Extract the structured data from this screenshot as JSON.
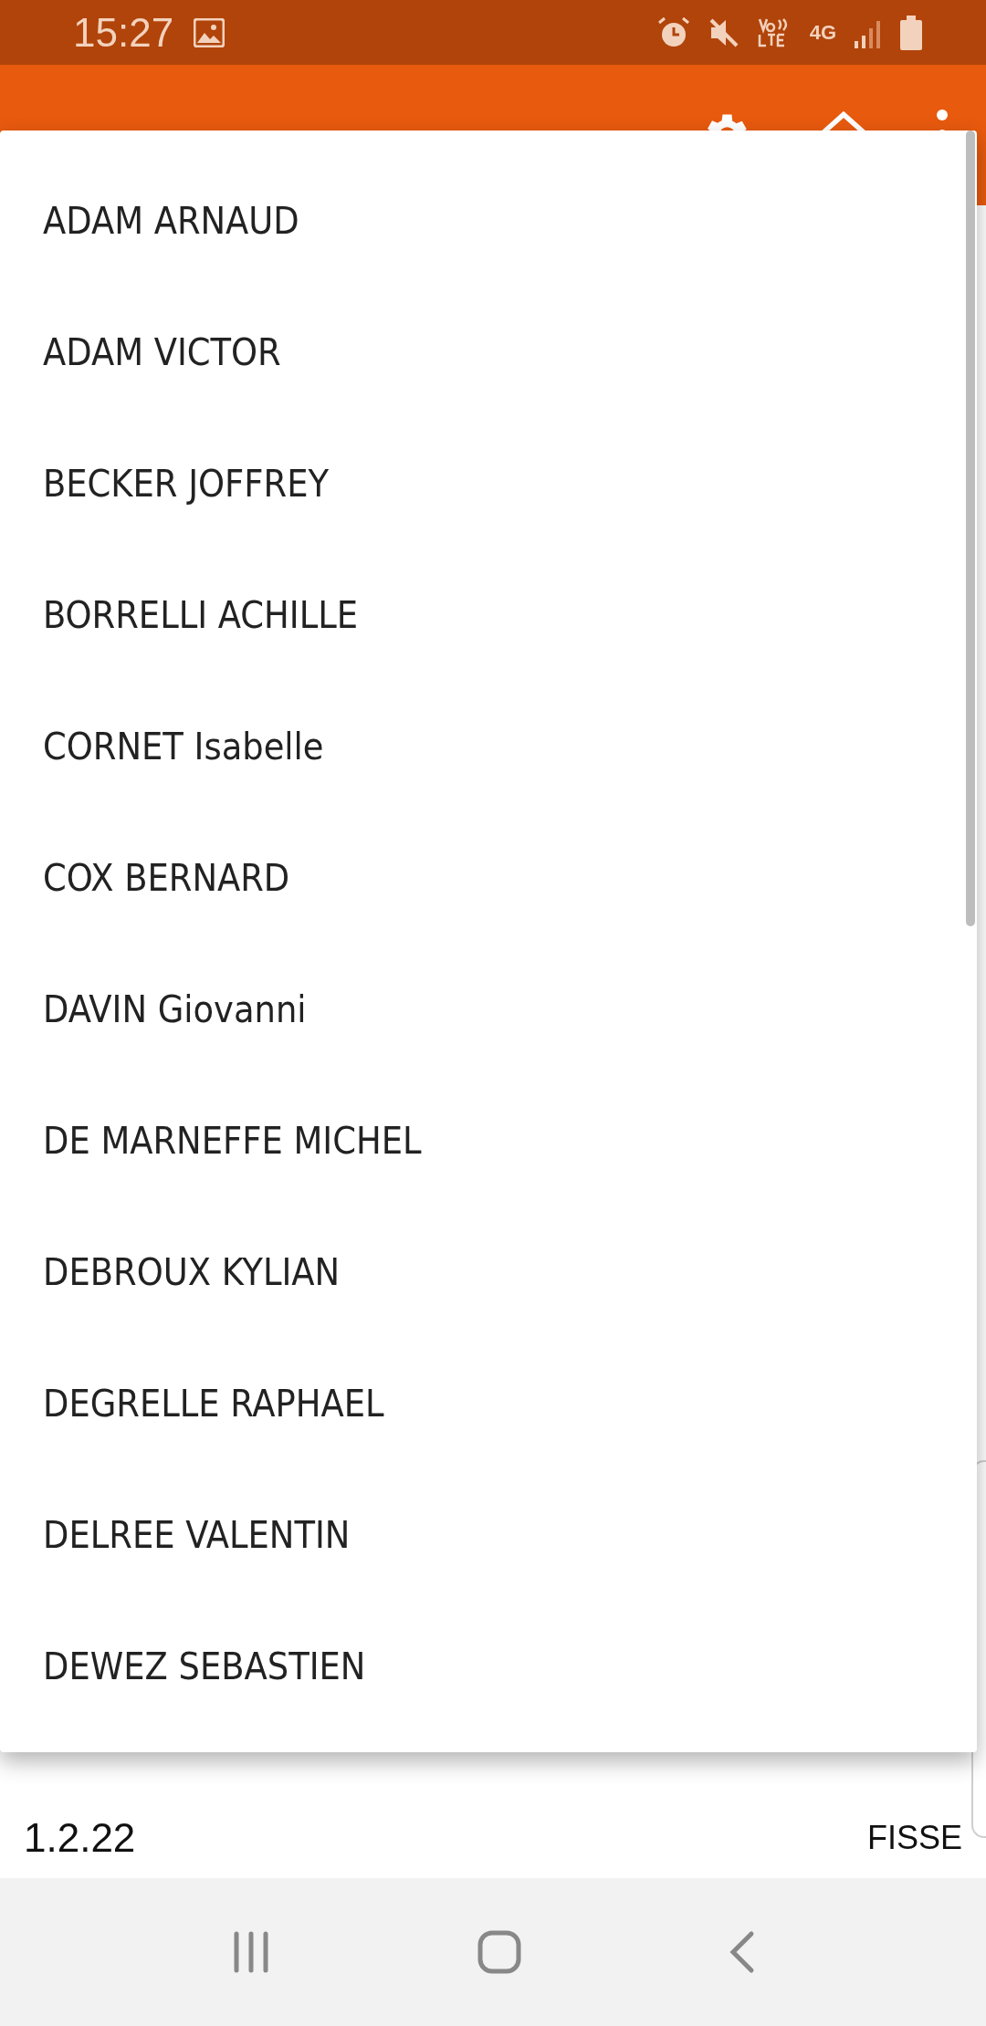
{
  "status_bar": {
    "time": "15:27",
    "network": "4G"
  },
  "dropdown": {
    "items": [
      {
        "label": "ADAM ARNAUD"
      },
      {
        "label": "ADAM VICTOR"
      },
      {
        "label": "BECKER JOFFREY"
      },
      {
        "label": "BORRELLI ACHILLE"
      },
      {
        "label": "CORNET Isabelle"
      },
      {
        "label": "COX BERNARD"
      },
      {
        "label": "DAVIN Giovanni"
      },
      {
        "label": "DE MARNEFFE MICHEL"
      },
      {
        "label": "DEBROUX KYLIAN"
      },
      {
        "label": "DEGRELLE RAPHAEL"
      },
      {
        "label": "DELREE VALENTIN"
      },
      {
        "label": "DEWEZ SEBASTIEN"
      }
    ]
  },
  "footer": {
    "version": "1.2.22",
    "user": "FISSE"
  }
}
